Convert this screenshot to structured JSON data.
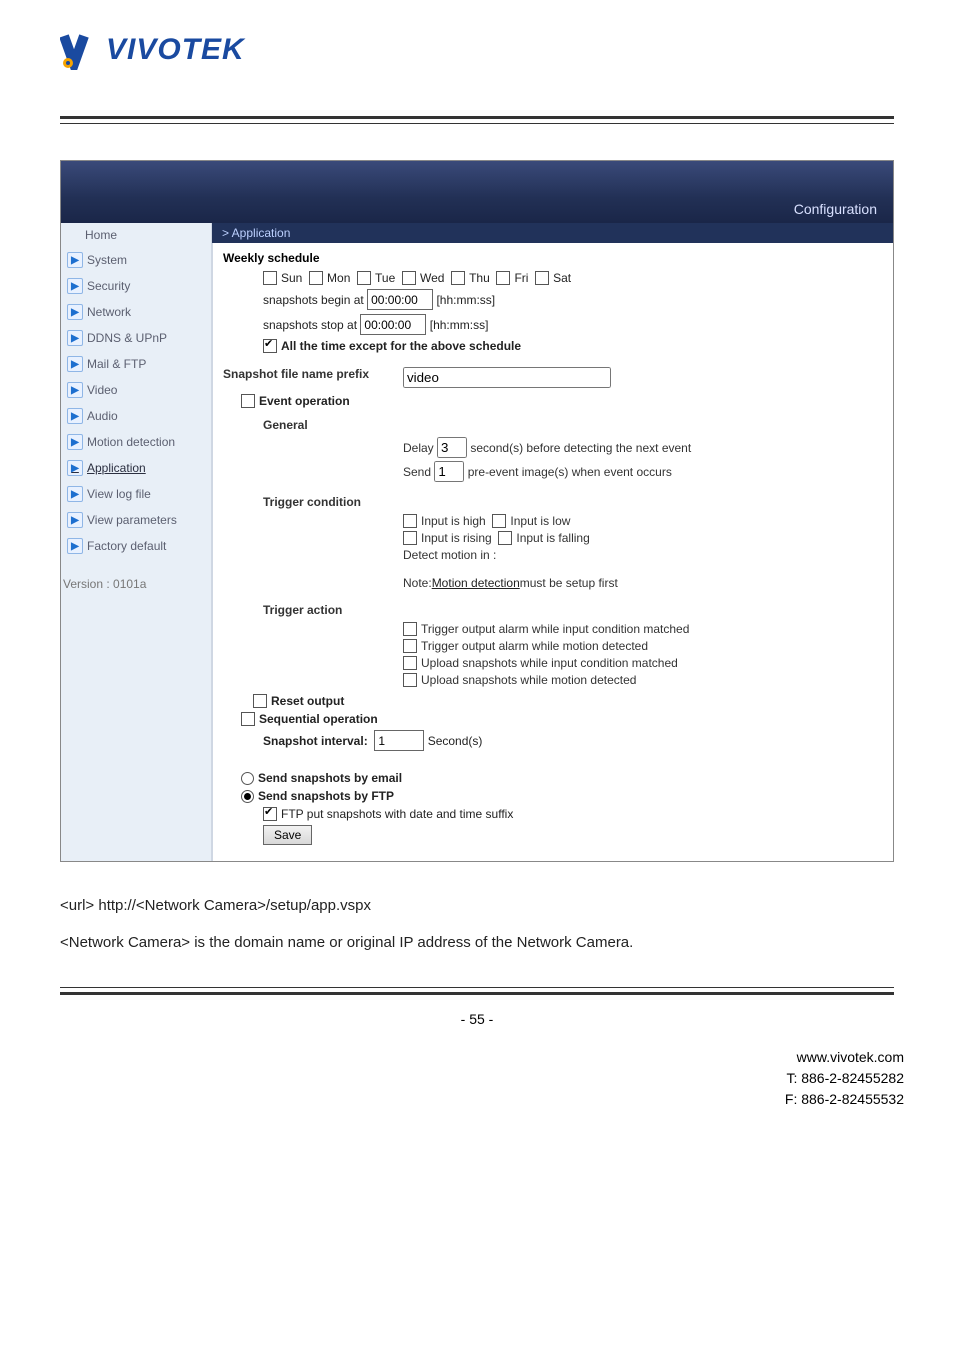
{
  "brand": {
    "name": "VIVOTEK"
  },
  "conf_title": "Configuration",
  "breadcrumb": "> Application",
  "sidebar": {
    "home": "Home",
    "items": [
      {
        "label": "System"
      },
      {
        "label": "Security"
      },
      {
        "label": "Network"
      },
      {
        "label": "DDNS & UPnP"
      },
      {
        "label": "Mail & FTP"
      },
      {
        "label": "Video"
      },
      {
        "label": "Audio"
      },
      {
        "label": "Motion detection"
      },
      {
        "label": "Application",
        "selected": true
      },
      {
        "label": "View log file"
      },
      {
        "label": "View parameters"
      },
      {
        "label": "Factory default"
      }
    ],
    "version": "Version : 0101a"
  },
  "weekly": {
    "title": "Weekly schedule",
    "days": [
      "Sun",
      "Mon",
      "Tue",
      "Wed",
      "Thu",
      "Fri",
      "Sat"
    ],
    "begin_label": "snapshots begin at",
    "begin_value": "00:00:00",
    "stop_label": "snapshots stop at",
    "stop_value": "00:00:00",
    "hint": "[hh:mm:ss]",
    "all_time": "All the time except for the above schedule"
  },
  "prefix": {
    "label": "Snapshot file name prefix",
    "value": "video"
  },
  "event": {
    "title": "Event operation",
    "general": "General",
    "delay_pre": "Delay",
    "delay_val": "3",
    "delay_post": "second(s) before detecting the next event",
    "send_pre": "Send",
    "send_val": "1",
    "send_post": "pre-event image(s) when event occurs",
    "trigger_cond": "Trigger condition",
    "tc": {
      "ih": "Input is high",
      "il": "Input is low",
      "ir": "Input is rising",
      "if_": "Input is falling",
      "detect": "Detect motion in :",
      "note_pre": "Note: ",
      "note_link": "Motion detection",
      "note_post": " must be setup first"
    },
    "trigger_act": "Trigger action",
    "ta": [
      "Trigger output alarm while input condition matched",
      "Trigger output alarm while motion detected",
      "Upload snapshots while input condition matched",
      "Upload snapshots while motion detected"
    ],
    "reset": "Reset output"
  },
  "seq": {
    "title": "Sequential operation",
    "interval_label": "Snapshot interval:",
    "interval_value": "1",
    "interval_unit": "Second(s)"
  },
  "send": {
    "email": "Send snapshots by email",
    "ftp": "Send snapshots by FTP",
    "suffix": "FTP put snapshots with date and time suffix"
  },
  "save": "Save",
  "doc": {
    "line1": "<url> http://<Network Camera>/setup/app.vspx",
    "line2": "<Network Camera> is the domain name or original IP address of the Network Camera."
  },
  "pageno": "- 55 -",
  "footer": {
    "url": "www.vivotek.com",
    "tel": "T: 886-2-82455282",
    "fax": "F: 886-2-82455532"
  }
}
